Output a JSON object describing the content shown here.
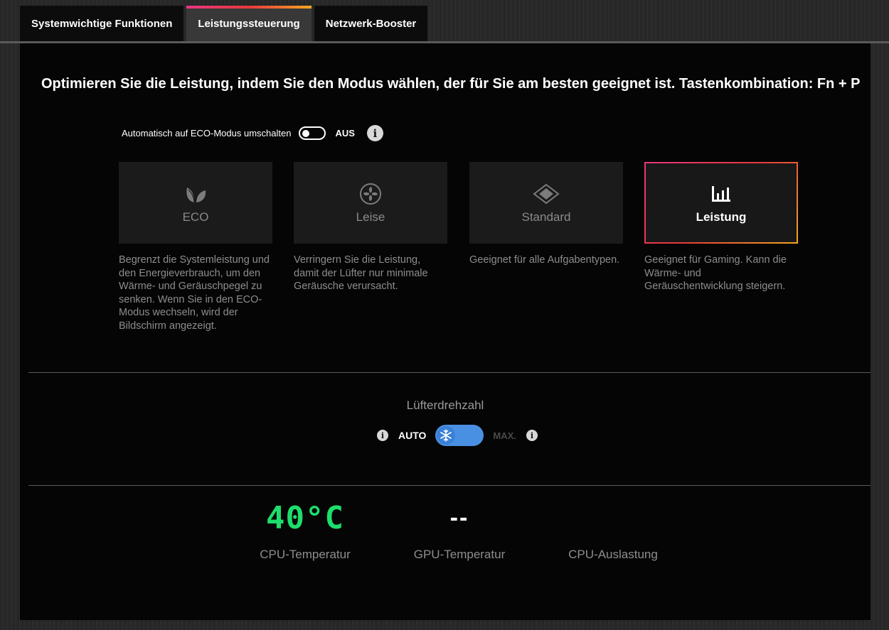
{
  "tabs": [
    {
      "label": "Systemwichtige Funktionen",
      "active": false
    },
    {
      "label": "Leistungssteuerung",
      "active": true
    },
    {
      "label": "Netzwerk-Booster",
      "active": false
    }
  ],
  "headline": "Optimieren Sie die Leistung, indem Sie den Modus wählen, der für Sie am besten geeignet ist.  Tastenkombination: Fn + P",
  "eco_switch": {
    "label": "Automatisch auf ECO-Modus umschalten",
    "state": "AUS",
    "info": "i"
  },
  "modes": [
    {
      "name": "ECO",
      "icon": "leaf-icon",
      "description": "Begrenzt die Systemleistung und den Energieverbrauch, um den Wärme- und Geräuschpegel zu senken. Wenn Sie in den ECO-Modus wechseln, wird der Bildschirm angezeigt.",
      "selected": false
    },
    {
      "name": "Leise",
      "icon": "fan-icon",
      "description": "Verringern Sie die Leistung, damit der Lüfter nur minimale Geräusche verursacht.",
      "selected": false
    },
    {
      "name": "Standard",
      "icon": "diamond-icon",
      "description": "Geeignet für alle Aufgabentypen.",
      "selected": false
    },
    {
      "name": "Leistung",
      "icon": "bars-icon",
      "description": "Geeignet für Gaming. Kann die Wärme- und Geräuschentwicklung steigern.",
      "selected": true
    }
  ],
  "fan": {
    "title": "Lüfterdrehzahl",
    "auto_label": "AUTO",
    "max_label": "MAX.",
    "info": "i",
    "mode": "AUTO"
  },
  "stats": {
    "cpu_temp": {
      "value": "40°C",
      "label": "CPU-Temperatur",
      "color": "#1ddd6b"
    },
    "gpu_temp": {
      "value": "--",
      "label": "GPU-Temperatur"
    },
    "cpu_load": {
      "value": "",
      "label": "CPU-Auslastung"
    }
  },
  "colors": {
    "accent_gradient": [
      "#e8367f",
      "#e83a3a",
      "#f5a623"
    ],
    "toggle_blue": "#4a90e2",
    "temp_green": "#1ddd6b"
  }
}
